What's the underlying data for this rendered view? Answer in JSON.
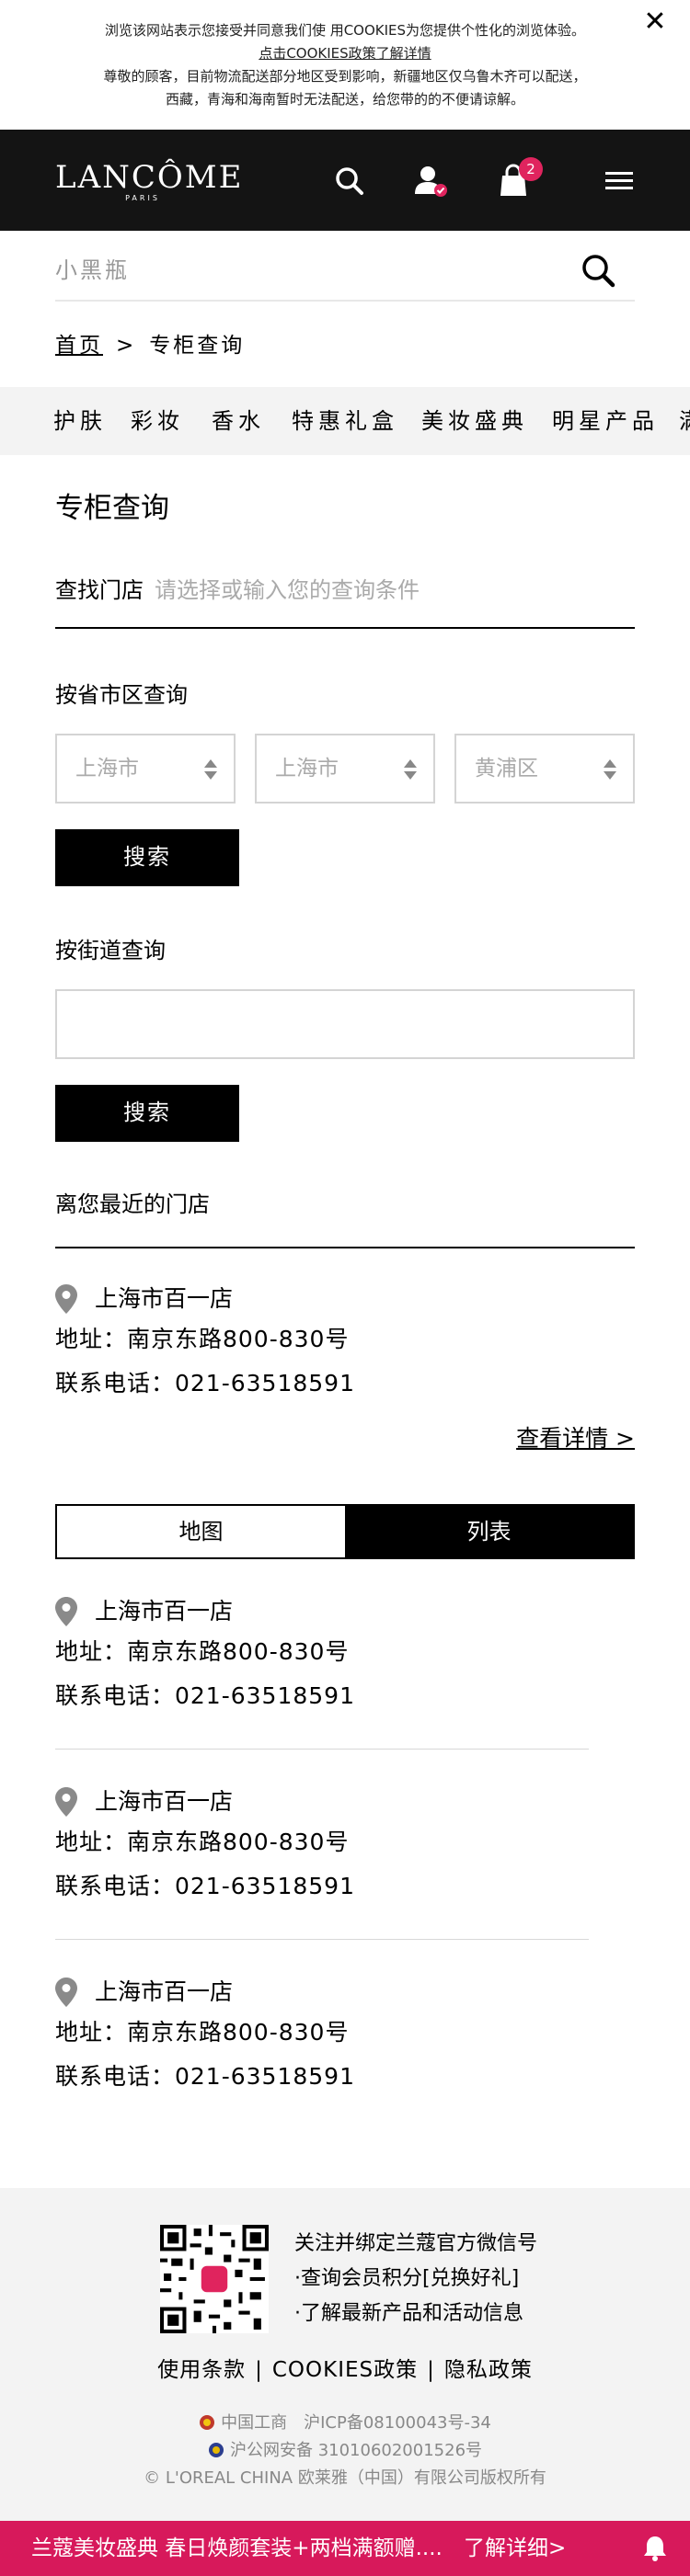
{
  "cookie": {
    "line1": "浏览该网站表示您接受并同意我们使 用COOKIES为您提供个性化的浏览体验。",
    "line2": "点击COOKIES政策了解详情",
    "line3": "尊敬的顾客，目前物流配送部分地区受到影响，新疆地区仅乌鲁木齐可以配送，",
    "line4": "西藏，青海和海南暂时无法配送，给您带的的不便请谅解。",
    "close": "✕"
  },
  "header": {
    "logo_brand": "LANCÔME",
    "logo_sub": "PARIS",
    "cart_count": "2"
  },
  "search": {
    "placeholder": "小黑瓶"
  },
  "breadcrumb": {
    "home": "首页",
    "separator": ">",
    "current": "专柜查询"
  },
  "nav": {
    "items": [
      "护肤",
      "彩妆",
      "香水",
      "特惠礼盒",
      "美妆盛典",
      "明星产品",
      "满"
    ]
  },
  "page": {
    "title": "专柜查询",
    "finder_label": "查找门店",
    "finder_placeholder": "请选择或输入您的查询条件",
    "by_region": "按省市区查询",
    "province": "上海市",
    "city": "上海市",
    "district": "黄浦区",
    "search_btn": "搜索",
    "by_street": "按街道查询",
    "street_value": "",
    "nearest": "离您最近的门店",
    "detail_link": "查看详情 >",
    "tab_map": "地图",
    "tab_list": "列表"
  },
  "stores": [
    {
      "name": "上海市百一店",
      "address": "地址：南京东路800-830号",
      "phone": "联系电话：021-63518591"
    },
    {
      "name": "上海市百一店",
      "address": "地址：南京东路800-830号",
      "phone": "联系电话：021-63518591"
    },
    {
      "name": "上海市百一店",
      "address": "地址：南京东路800-830号",
      "phone": "联系电话：021-63518591"
    },
    {
      "name": "上海市百一店",
      "address": "地址：南京东路800-830号",
      "phone": "联系电话：021-63518591"
    }
  ],
  "footer": {
    "wechat_title": "关注并绑定兰蔻官方微信号",
    "wechat_line1": "·查询会员积分[兑换好礼]",
    "wechat_line2": "·了解最新产品和活动信息",
    "link_terms": "使用条款",
    "link_cookies": "COOKIES政策",
    "link_privacy": "隐私政策",
    "link_sep": "|",
    "icp1": "中国工商　沪ICP备08100043号-34",
    "icp2": "沪公网安备 31010602001526号",
    "copyright": "© L'OREAL CHINA 欧莱雅（中国）有限公司版权所有"
  },
  "promo": {
    "message": "兰蔻美妆盛典 春日焕颜套装+两档满额赠....",
    "more": "了解详细>"
  },
  "colors": {
    "header_bg": "#141414",
    "accent": "#e0245e",
    "promo_bg": "#d7195b"
  }
}
